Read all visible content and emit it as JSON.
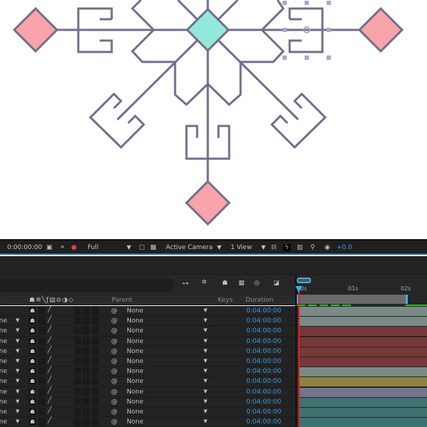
{
  "viewer_toolbar": {
    "timecode": "0:00:00:00",
    "resolution": "Full",
    "camera": "Active Camera",
    "views": "1 View",
    "exposure": "+0.0",
    "icons": [
      "camera-icon",
      "channels-icon",
      "rgb-icon",
      "region-icon",
      "transparency-grid-icon",
      "fast-preview-icon",
      "timeline-icon",
      "flowchart-icon",
      "exposure-icon"
    ]
  },
  "timeline": {
    "ruler": [
      "0s",
      "01s",
      "02s"
    ],
    "columns": {
      "mode": "t",
      "parent": "Parent",
      "keys": "Keys",
      "duration": "Duration"
    },
    "rows": [
      {
        "mode": "",
        "parent": "None",
        "duration": "0:04:00:00",
        "color": "#7a8a86"
      },
      {
        "mode": "None",
        "parent": "None",
        "duration": "0:04:00:00",
        "color": "#7a8a86"
      },
      {
        "mode": "None",
        "parent": "None",
        "duration": "0:04:00:00",
        "color": "#763838"
      },
      {
        "mode": "None",
        "parent": "None",
        "duration": "0:04:00:00",
        "color": "#763838"
      },
      {
        "mode": "None",
        "parent": "None",
        "duration": "0:04:00:00",
        "color": "#763838"
      },
      {
        "mode": "None",
        "parent": "None",
        "duration": "0:04:00:00",
        "color": "#763838"
      },
      {
        "mode": "None",
        "parent": "None",
        "duration": "0:04:00:00",
        "color": "#7a8a86"
      },
      {
        "mode": "None",
        "parent": "None",
        "duration": "0:04:00:00",
        "color": "#8a8440"
      },
      {
        "mode": "None",
        "parent": "None",
        "duration": "0:04:00:00",
        "color": "#74748a"
      },
      {
        "mode": "None",
        "parent": "None",
        "duration": "0:04:00:00",
        "color": "#3e7371"
      },
      {
        "mode": "None",
        "parent": "None",
        "duration": "0:04:00:00",
        "color": "#3e7371"
      },
      {
        "mode": "None",
        "parent": "None",
        "duration": "0:04:00:00",
        "color": "#3e7371"
      }
    ]
  },
  "colors": {
    "stroke": "#6f6e8c",
    "center": "#93e8dc",
    "pink": "#f9a3ab",
    "accent": "#3a9ad8",
    "playhead": "#e02020"
  }
}
